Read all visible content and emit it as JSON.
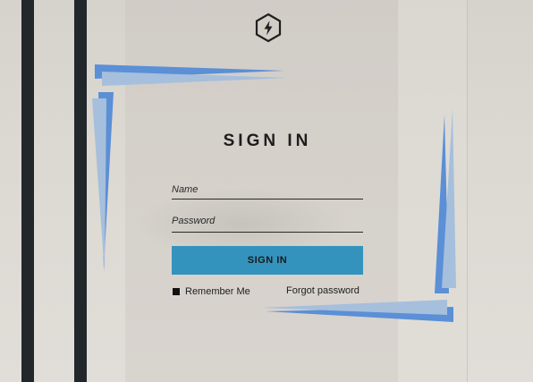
{
  "logo": {
    "icon": "lightning-hexagon-icon"
  },
  "form": {
    "title": "SIGN IN",
    "name_placeholder": "Name",
    "password_placeholder": "Password",
    "submit_label": "SIGN IN",
    "remember_label": "Remember Me",
    "forgot_label": "Forgot password"
  },
  "colors": {
    "accent": "#3393bd",
    "decor_blue": "#5b8fd6",
    "decor_light_blue": "#a6bfdc",
    "stripe": "#22272c"
  }
}
